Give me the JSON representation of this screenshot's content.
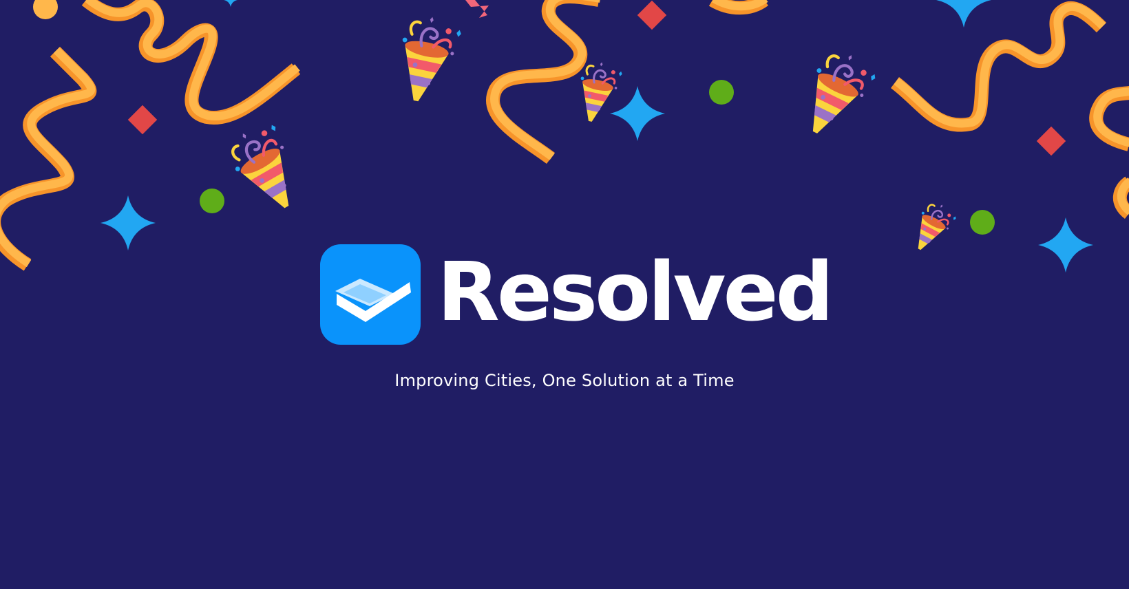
{
  "brand": {
    "name": "Resolved",
    "tagline": "Improving Cities, One Solution at a Time"
  },
  "colors": {
    "background": "#201d64",
    "text": "#ffffff",
    "logo_tile": "#0a93fb",
    "logo_light": "#cbe9ff",
    "logo_mid": "#8fd0ff",
    "streamer_light": "#ffb74b",
    "streamer_dark": "#f7942a",
    "diamond": "#e24747",
    "dot": "#5fad19",
    "sparkle": "#22a7f2",
    "cone_yellow": "#fbd43d",
    "cone_pink": "#f25a6a",
    "cone_purple": "#9a72c7",
    "cone_orange": "#e36833"
  },
  "decorations": {
    "icons": [
      "party-popper-icon",
      "streamer",
      "sparkle-icon",
      "diamond",
      "confetti-dot"
    ]
  }
}
